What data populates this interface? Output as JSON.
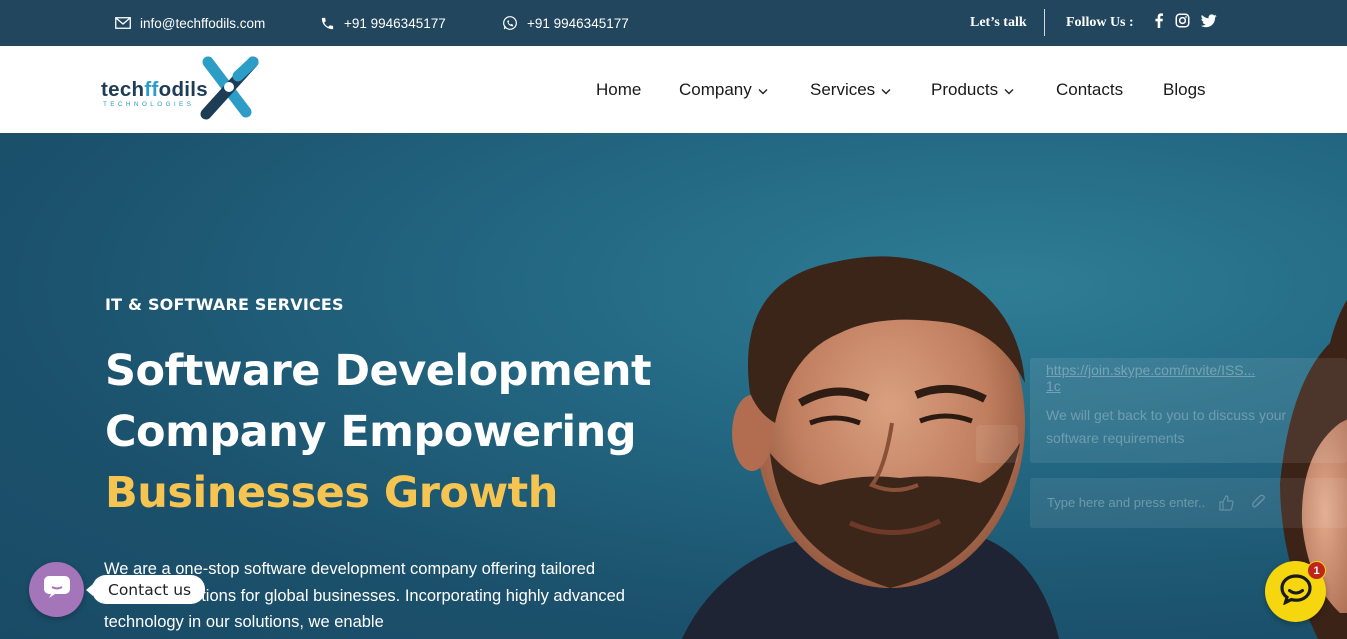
{
  "topbar": {
    "email": "info@techffodils.com",
    "phone": "+91 9946345177",
    "whatsapp": "+91 9946345177",
    "lets_talk": "Let’s talk",
    "follow_us": "Follow Us :",
    "social_icons": [
      "facebook-icon",
      "instagram-icon",
      "twitter-icon"
    ]
  },
  "logo": {
    "name_prefix": "tech",
    "name_highlight": "ff",
    "name_suffix": "odils",
    "subtitle": "TECHNOLOGIES"
  },
  "nav": {
    "items": [
      {
        "label": "Home",
        "dropdown": false
      },
      {
        "label": "Company",
        "dropdown": true
      },
      {
        "label": "Services",
        "dropdown": true
      },
      {
        "label": "Products",
        "dropdown": true
      },
      {
        "label": "Contacts",
        "dropdown": false
      },
      {
        "label": "Blogs",
        "dropdown": false
      }
    ]
  },
  "hero": {
    "eyebrow": "IT & SOFTWARE SERVICES",
    "headline_line1": "Software Development",
    "headline_line2": "Company Empowering",
    "headline_accent": "Businesses Growth",
    "lead": "We are a one-stop software development company offering tailored software solutions for global businesses. Incorporating highly advanced technology in our solutions, we enable"
  },
  "skype_widget": {
    "link": "https://join.skype.com/invite/ISS...",
    "link_line2": "1c",
    "message": "We will get back to you to discuss your software requirements",
    "input_placeholder": "Type here and press enter.."
  },
  "contact_widget": {
    "label": "Contact us"
  },
  "chat_widget": {
    "badge_count": "1"
  },
  "colors": {
    "topbar_bg": "#21465e",
    "hero_bg": "#1e5570",
    "accent_yellow": "#f6c551",
    "brand_blue": "#2b9dc7",
    "brand_dark": "#1d3c56",
    "contact_purple": "#a575b9",
    "chat_yellow": "#f5d60f"
  }
}
